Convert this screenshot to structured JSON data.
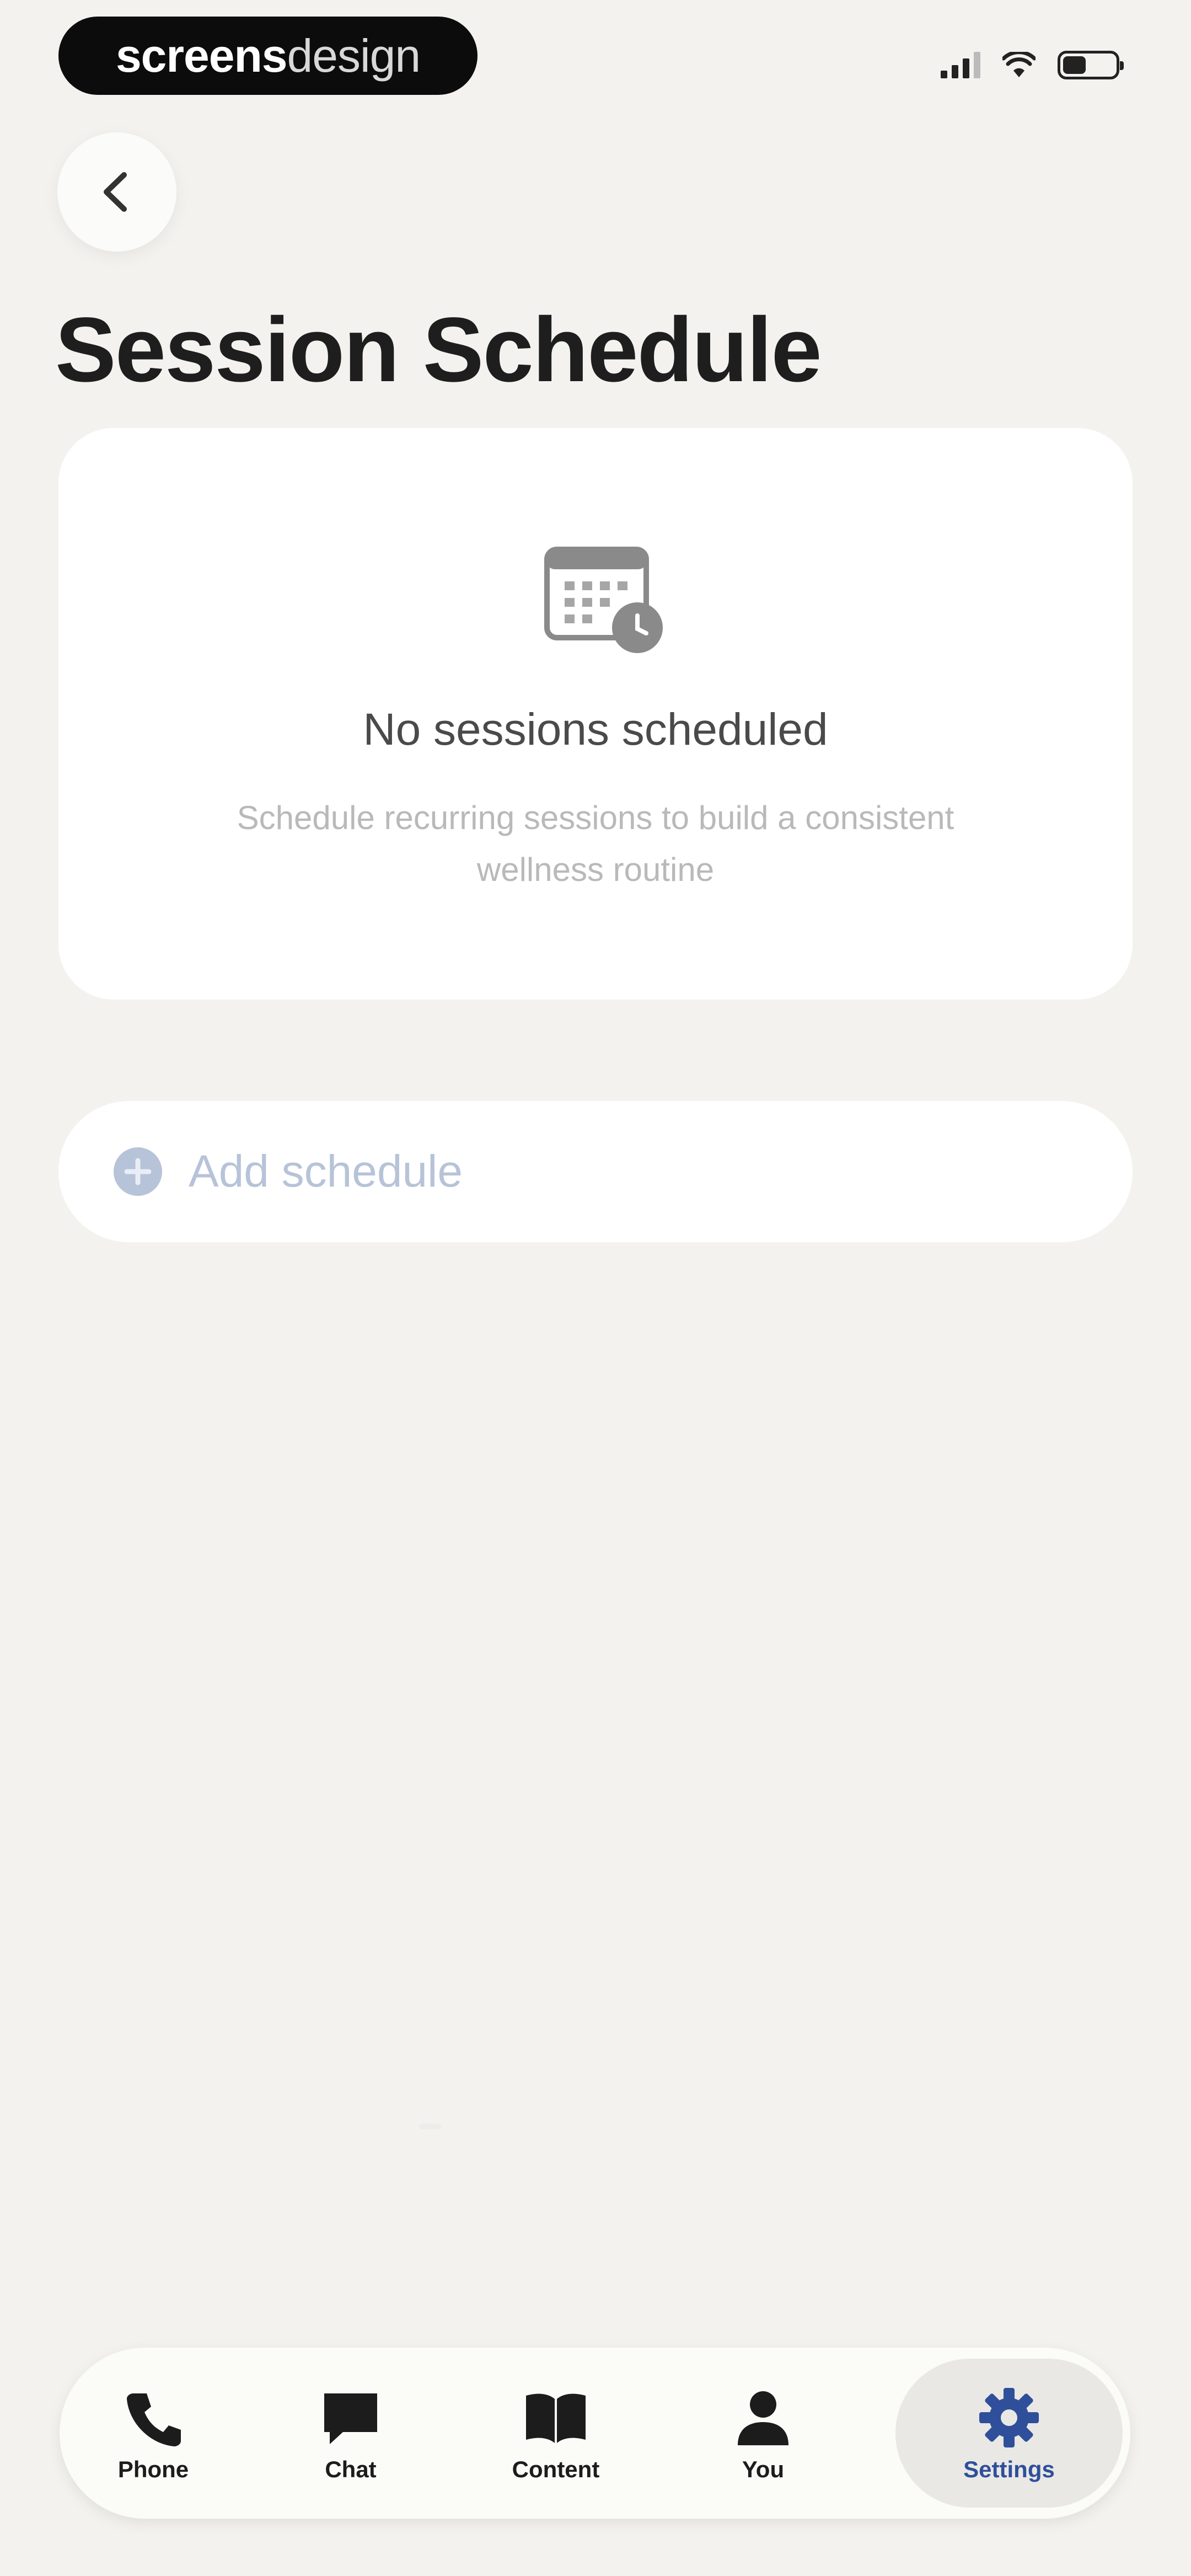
{
  "status_bar": {
    "brand_bold": "screens",
    "brand_light": "design"
  },
  "header": {
    "back_icon": "chevron-left-icon",
    "title": "Session Schedule"
  },
  "empty_state": {
    "icon": "calendar-clock-icon",
    "title": "No sessions scheduled",
    "subtitle": "Schedule recurring sessions to build a consistent wellness routine"
  },
  "add_schedule": {
    "icon": "plus-circle-icon",
    "label": "Add schedule"
  },
  "tabbar": {
    "active": "Settings",
    "accent_color": "#2f4f9a",
    "tabs": [
      {
        "label": "Phone",
        "icon": "phone-icon"
      },
      {
        "label": "Chat",
        "icon": "chat-icon"
      },
      {
        "label": "Content",
        "icon": "book-icon"
      },
      {
        "label": "You",
        "icon": "user-icon"
      },
      {
        "label": "Settings",
        "icon": "gear-icon"
      }
    ]
  }
}
